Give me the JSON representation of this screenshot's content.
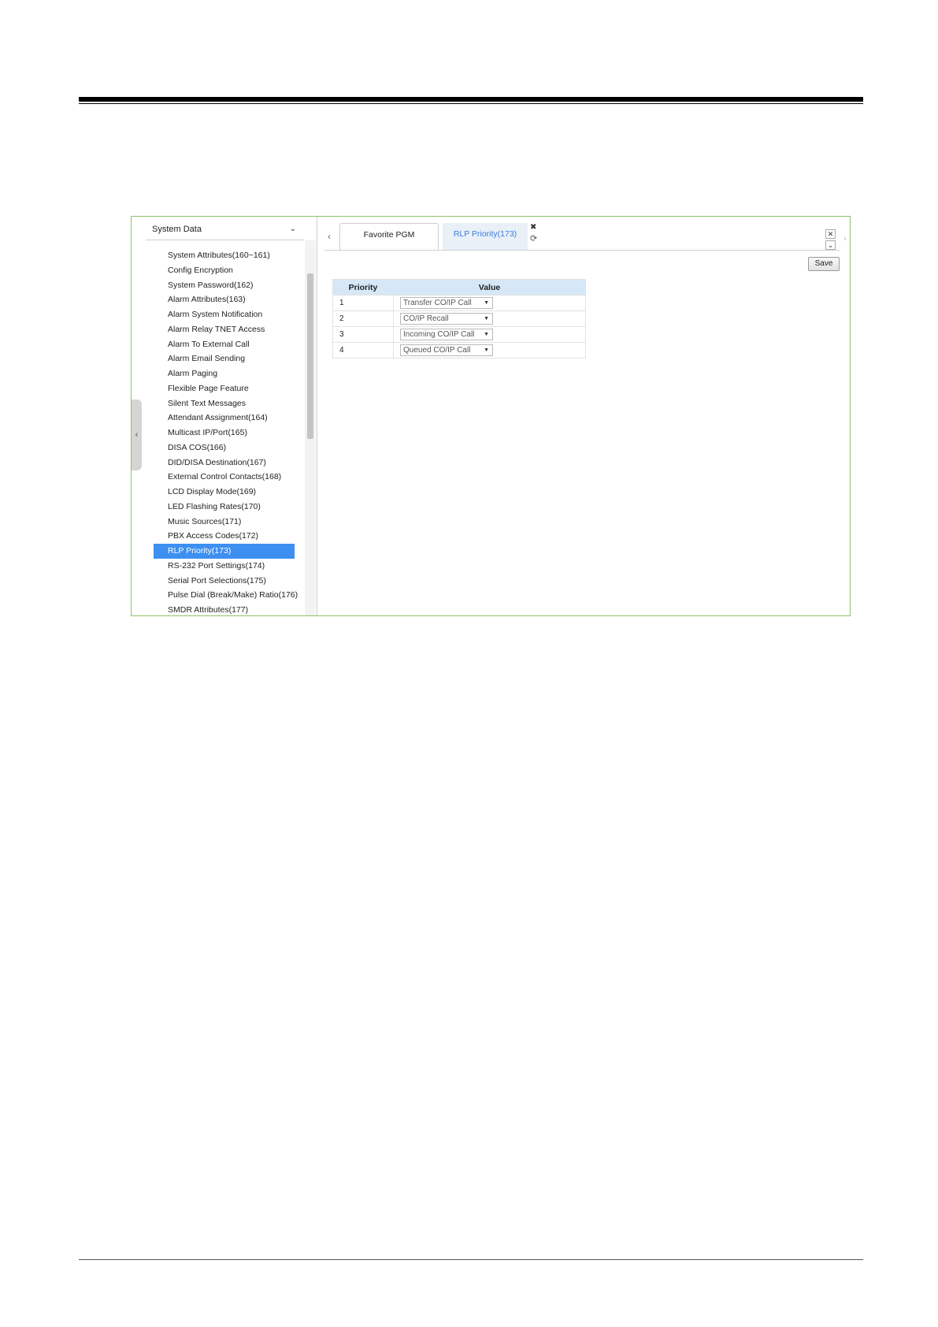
{
  "sidebar": {
    "header": "System Data",
    "items": [
      "System Attributes(160~161)",
      "Config Encryption",
      "System Password(162)",
      "Alarm Attributes(163)",
      "Alarm System Notification",
      "Alarm Relay TNET Access",
      "Alarm To External Call",
      "Alarm Email Sending",
      "Alarm Paging",
      "Flexible Page Feature",
      "Silent Text Messages",
      "Attendant Assignment(164)",
      "Multicast IP/Port(165)",
      "DISA COS(166)",
      "DID/DISA Destination(167)",
      "External Control Contacts(168)",
      "LCD Display Mode(169)",
      "LED Flashing Rates(170)",
      "Music Sources(171)",
      "PBX Access Codes(172)",
      "RLP Priority(173)",
      "RS-232 Port Settings(174)",
      "Serial Port Selections(175)",
      "Pulse Dial (Break/Make) Ratio(176)",
      "SMDR Attributes(177)"
    ],
    "active_index": 20
  },
  "tabs": [
    {
      "label": "Favorite PGM"
    },
    {
      "label": "RLP Priority(173)"
    }
  ],
  "toolbar": {
    "save_label": "Save"
  },
  "table": {
    "headers": [
      "Priority",
      "Value"
    ],
    "rows": [
      {
        "priority": "1",
        "value": "Transfer CO/IP Call"
      },
      {
        "priority": "2",
        "value": "CO/IP Recall"
      },
      {
        "priority": "3",
        "value": "Incoming CO/IP Call"
      },
      {
        "priority": "4",
        "value": "Queued CO/IP Call"
      }
    ]
  },
  "colors": {
    "frame_border": "#8cc56a",
    "active_item": "#3d8ff0",
    "header_bg": "#d6e8f7",
    "active_tab_text": "#3b7ed8"
  }
}
